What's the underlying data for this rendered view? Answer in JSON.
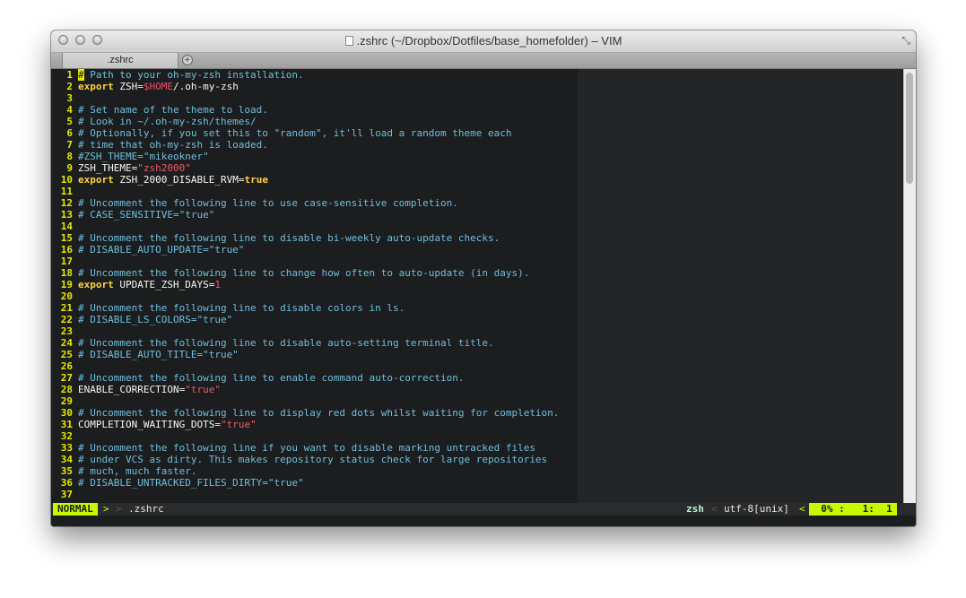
{
  "window": {
    "title": ".zshrc (~/Dropbox/Dotfiles/base_homefolder) – VIM"
  },
  "tabs": [
    {
      "label": ".zshrc"
    }
  ],
  "tab_add_symbol": "+",
  "editor": {
    "lines": [
      {
        "n": "1",
        "parts": [
          {
            "t": "#",
            "c": "cursor"
          },
          {
            "t": " Path to your oh-my-zsh installation.",
            "c": "comment"
          }
        ]
      },
      {
        "n": "2",
        "parts": [
          {
            "t": "export",
            "c": "keyword"
          },
          {
            "t": " ZSH=",
            "c": "text"
          },
          {
            "t": "$HOME",
            "c": "var"
          },
          {
            "t": "/.oh-my-zsh",
            "c": "text"
          }
        ]
      },
      {
        "n": "3",
        "parts": []
      },
      {
        "n": "4",
        "parts": [
          {
            "t": "# Set name of the theme to load.",
            "c": "comment"
          }
        ]
      },
      {
        "n": "5",
        "parts": [
          {
            "t": "# Look in ~/.oh-my-zsh/themes/",
            "c": "comment"
          }
        ]
      },
      {
        "n": "6",
        "parts": [
          {
            "t": "# Optionally, if you set this to \"random\", it'll load a random theme each",
            "c": "comment"
          }
        ]
      },
      {
        "n": "7",
        "parts": [
          {
            "t": "# time that oh-my-zsh is loaded.",
            "c": "comment"
          }
        ]
      },
      {
        "n": "8",
        "parts": [
          {
            "t": "#ZSH_THEME=\"mikeokner\"",
            "c": "comment"
          }
        ]
      },
      {
        "n": "9",
        "parts": [
          {
            "t": "ZSH_THEME=",
            "c": "text"
          },
          {
            "t": "\"zsh2000\"",
            "c": "string"
          }
        ]
      },
      {
        "n": "10",
        "parts": [
          {
            "t": "export",
            "c": "keyword"
          },
          {
            "t": " ZSH_2000_DISABLE_RVM=",
            "c": "text"
          },
          {
            "t": "true",
            "c": "bool"
          }
        ]
      },
      {
        "n": "11",
        "parts": []
      },
      {
        "n": "12",
        "parts": [
          {
            "t": "# Uncomment the following line to use case-sensitive completion.",
            "c": "comment"
          }
        ]
      },
      {
        "n": "13",
        "parts": [
          {
            "t": "# CASE_SENSITIVE=\"true\"",
            "c": "comment"
          }
        ]
      },
      {
        "n": "14",
        "parts": []
      },
      {
        "n": "15",
        "parts": [
          {
            "t": "# Uncomment the following line to disable bi-weekly auto-update checks.",
            "c": "comment"
          }
        ]
      },
      {
        "n": "16",
        "parts": [
          {
            "t": "# DISABLE_AUTO_UPDATE=\"true\"",
            "c": "comment"
          }
        ]
      },
      {
        "n": "17",
        "parts": []
      },
      {
        "n": "18",
        "parts": [
          {
            "t": "# Uncomment the following line to change how often to auto-update (in days).",
            "c": "comment"
          }
        ]
      },
      {
        "n": "19",
        "parts": [
          {
            "t": "export",
            "c": "keyword"
          },
          {
            "t": " UPDATE_ZSH_DAYS=",
            "c": "text"
          },
          {
            "t": "1",
            "c": "string"
          }
        ]
      },
      {
        "n": "20",
        "parts": []
      },
      {
        "n": "21",
        "parts": [
          {
            "t": "# Uncomment the following line to disable colors in ls.",
            "c": "comment"
          }
        ]
      },
      {
        "n": "22",
        "parts": [
          {
            "t": "# DISABLE_LS_COLORS=\"true\"",
            "c": "comment"
          }
        ]
      },
      {
        "n": "23",
        "parts": []
      },
      {
        "n": "24",
        "parts": [
          {
            "t": "# Uncomment the following line to disable auto-setting terminal title.",
            "c": "comment"
          }
        ]
      },
      {
        "n": "25",
        "parts": [
          {
            "t": "# DISABLE_AUTO_TITLE=\"true\"",
            "c": "comment"
          }
        ]
      },
      {
        "n": "26",
        "parts": []
      },
      {
        "n": "27",
        "parts": [
          {
            "t": "# Uncomment the following line to enable command auto-correction.",
            "c": "comment"
          }
        ]
      },
      {
        "n": "28",
        "parts": [
          {
            "t": "ENABLE_CORRECTION=",
            "c": "text"
          },
          {
            "t": "\"true\"",
            "c": "string"
          }
        ]
      },
      {
        "n": "29",
        "parts": []
      },
      {
        "n": "30",
        "parts": [
          {
            "t": "# Uncomment the following line to display red dots whilst waiting for completion.",
            "c": "comment"
          }
        ]
      },
      {
        "n": "31",
        "parts": [
          {
            "t": "COMPLETION_WAITING_DOTS=",
            "c": "text"
          },
          {
            "t": "\"true\"",
            "c": "string"
          }
        ]
      },
      {
        "n": "32",
        "parts": []
      },
      {
        "n": "33",
        "parts": [
          {
            "t": "# Uncomment the following line if you want to disable marking untracked files",
            "c": "comment"
          }
        ]
      },
      {
        "n": "34",
        "parts": [
          {
            "t": "# under VCS as dirty. This makes repository status check for large repositories",
            "c": "comment"
          }
        ]
      },
      {
        "n": "35",
        "parts": [
          {
            "t": "# much, much faster.",
            "c": "comment"
          }
        ]
      },
      {
        "n": "36",
        "parts": [
          {
            "t": "# DISABLE_UNTRACKED_FILES_DIRTY=\"true\"",
            "c": "comment"
          }
        ]
      },
      {
        "n": "37",
        "parts": []
      }
    ]
  },
  "statusline": {
    "mode": "NORMAL",
    "sep_after_mode": ">",
    "sep_dim": ">",
    "filename": ".zshrc",
    "filetype": "zsh",
    "sep_before_enc": "<",
    "encoding": "utf-8[unix]",
    "sep_before_pos": "<",
    "position": "  0% :   1:  1"
  },
  "colors": {
    "background": "#1b1d1e",
    "comment": "#6fbfdf",
    "keyword": "#ffd23f",
    "string": "#ef5a67",
    "line_number": "#e8e800",
    "mode_bg": "#c7f800"
  }
}
